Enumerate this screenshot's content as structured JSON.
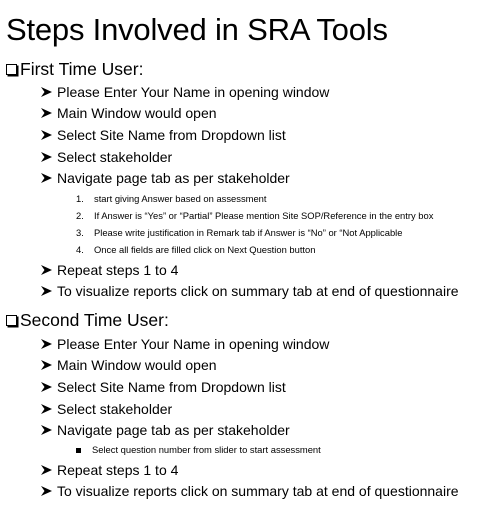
{
  "title": "Steps Involved in SRA Tools",
  "first_time_user": {
    "heading": "First Time User:",
    "steps": [
      "Please Enter Your Name in opening window",
      "Main Window would open",
      "Select Site Name from Dropdown list",
      "Select stakeholder",
      "Navigate page tab as per stakeholder"
    ],
    "substeps": [
      "start giving Answer based on assessment",
      "If Answer is “Yes” or “Partial” Please mention Site SOP/Reference in the entry box",
      "Please write justification in Remark tab if Answer is “No” or “Not Applicable",
      "Once all fields are filled click on Next Question button"
    ],
    "substep_numbers": [
      "1.",
      "2.",
      "3.",
      "4."
    ],
    "after_steps": [
      "Repeat steps 1 to 4",
      "To visualize reports click on summary tab at end of questionnaire"
    ]
  },
  "second_time_user": {
    "heading": "Second Time User:",
    "steps": [
      "Please Enter Your Name in opening window",
      "Main Window would open",
      "Select Site Name from Dropdown list",
      "Select stakeholder",
      "Navigate page tab as per stakeholder"
    ],
    "substeps": [
      "Select question number from slider to start assessment"
    ],
    "after_steps": [
      "Repeat steps 1 to 4",
      "To visualize reports click on summary tab at end of questionnaire"
    ]
  },
  "icons": {
    "section_marker": "checkbox-icon",
    "step_marker": "arrowhead-icon",
    "substep_marker": "square-bullet-icon"
  }
}
